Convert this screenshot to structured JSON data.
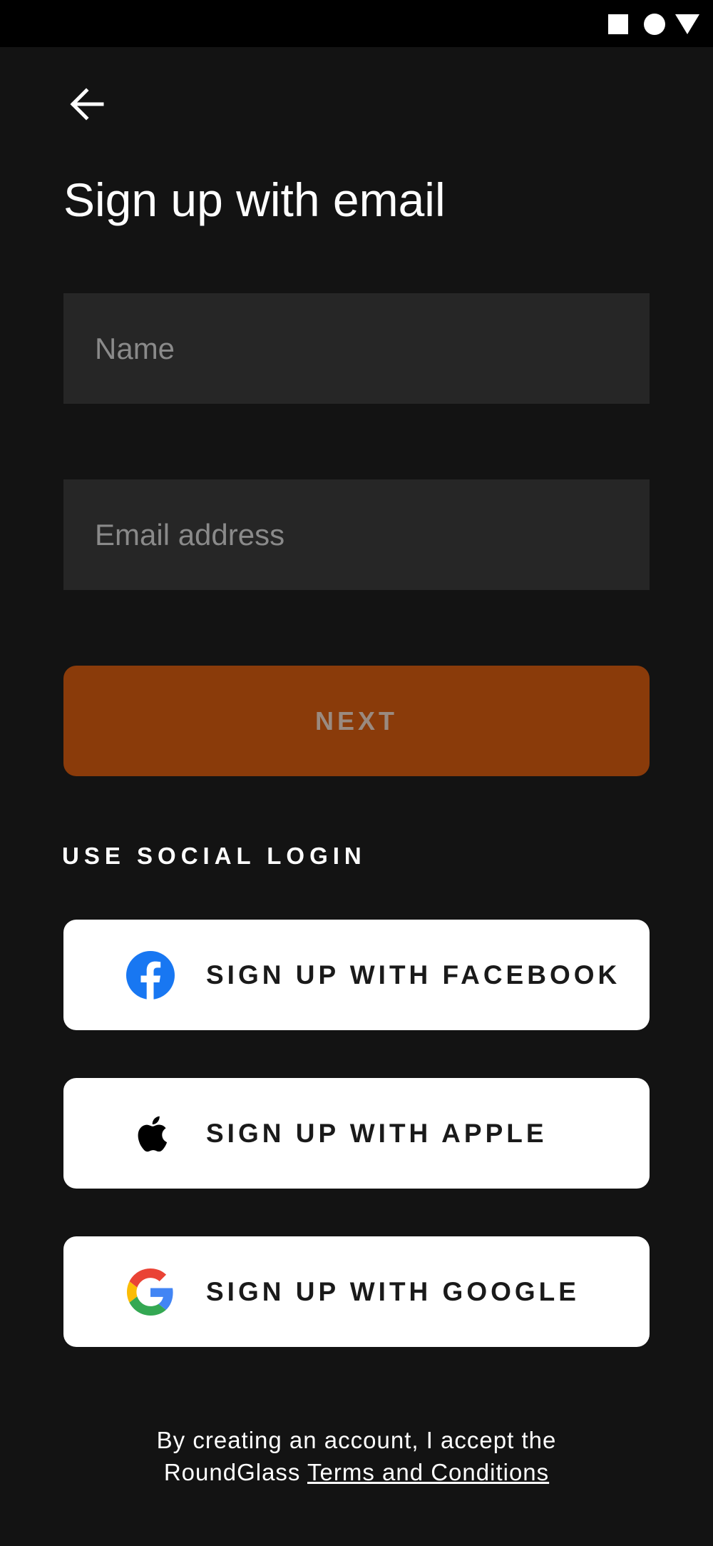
{
  "status_bar": {
    "icons": [
      "stop-square-icon",
      "record-circle-icon",
      "signal-triangle-icon"
    ]
  },
  "header": {
    "back_icon": "arrow-left-icon",
    "title": "Sign up with email"
  },
  "form": {
    "name_placeholder": "Name",
    "name_value": "",
    "email_placeholder": "Email address",
    "email_value": "",
    "next_label": "NEXT"
  },
  "social": {
    "section_label": "USE SOCIAL LOGIN",
    "buttons": [
      {
        "label": "SIGN UP WITH FACEBOOK",
        "icon": "facebook-icon"
      },
      {
        "label": "SIGN UP WITH APPLE",
        "icon": "apple-icon"
      },
      {
        "label": "SIGN UP WITH GOOGLE",
        "icon": "google-icon"
      }
    ]
  },
  "footer": {
    "line1": "By creating an account, I accept the",
    "line2_prefix": "RoundGlass ",
    "terms_link": "Terms and Conditions"
  },
  "colors": {
    "background": "#131313",
    "field_bg": "#262626",
    "next_button_bg": "#8a3b0a",
    "facebook_blue": "#1877F2"
  }
}
